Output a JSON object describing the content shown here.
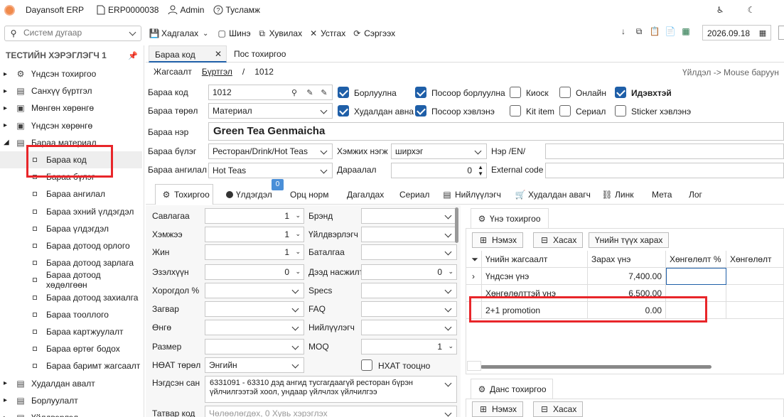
{
  "app": {
    "name": "Dayansoft ERP",
    "doc": "ERP0000038",
    "user": "Admin",
    "help": "Тусламж"
  },
  "search": {
    "placeholder": "Систем дугаар"
  },
  "toolbar": {
    "save": "Хадгалах",
    "new": "Шинэ",
    "copy": "Хувилах",
    "delete": "Устгах",
    "refresh": "Сэргээх",
    "date": "2026.09.18"
  },
  "sidebar": {
    "title": "ТЕСТИЙН ХЭРЭГЛЭГЧ 1",
    "items": [
      {
        "label": "Үндсэн тохиргоо",
        "level": 0
      },
      {
        "label": "Санхүү бүртгэл",
        "level": 0
      },
      {
        "label": "Мөнгөн хөрөнгө",
        "level": 0
      },
      {
        "label": "Үндсэн хөрөнгө",
        "level": 0
      },
      {
        "label": "Бараа материал",
        "level": 0
      },
      {
        "label": "Бараа код",
        "level": 1
      },
      {
        "label": "Бараа бүлэг",
        "level": 1
      },
      {
        "label": "Бараа ангилал",
        "level": 1
      },
      {
        "label": "Бараа эхний үлдэгдэл",
        "level": 1
      },
      {
        "label": "Бараа үлдэгдэл",
        "level": 1
      },
      {
        "label": "Бараа дотоод орлого",
        "level": 1
      },
      {
        "label": "Бараа дотоод зарлага",
        "level": 1
      },
      {
        "label": "Бараа дотоод хөдөлгөөн",
        "level": 1
      },
      {
        "label": "Бараа дотоод захиалга",
        "level": 1
      },
      {
        "label": "Бараа тооллого",
        "level": 1
      },
      {
        "label": "Бараа картжуулалт",
        "level": 1
      },
      {
        "label": "Бараа өртөг бодох",
        "level": 1
      },
      {
        "label": "Бараа баримт жагсаалт",
        "level": 1
      },
      {
        "label": "Худалдан авалт",
        "level": 0
      },
      {
        "label": "Борлуулалт",
        "level": 0
      },
      {
        "label": "Үйлдвэрлэл",
        "level": 0
      }
    ]
  },
  "tabs": {
    "t1": "Бараа код",
    "t2": "Пос тохиргоо"
  },
  "crumb": {
    "list": "Жагсаалт",
    "reg": "Бүртгэл",
    "slash": "/",
    "code": "1012",
    "hint": "Үйлдэл -> Mouse баруун"
  },
  "form": {
    "code_label": "Бараа код",
    "code": "1012",
    "type_label": "Бараа төрөл",
    "type": "Материал",
    "name_label": "Бараа нэр",
    "name": "Green Tea Genmaicha",
    "group_label": "Бараа бүлэг",
    "group": "Ресторан/Drink/Hot Teas",
    "cat_label": "Бараа ангилал",
    "cat": "Hot Teas",
    "unit_label": "Хэмжих нэгж",
    "unit": "ширхэг",
    "seq_label": "Дараалал",
    "seq": "0",
    "en_label": "Нэр /EN/",
    "ext_label": "External code"
  },
  "checks": {
    "c1": "Борлуулна",
    "c2": "Посоор борлуулна",
    "c3": "Киоск",
    "c4": "Онлайн",
    "c5": "Идэвхтэй",
    "c6": "Худалдан авна",
    "c7": "Посоор хэвлэнэ",
    "c8": "Kit item",
    "c9": "Сериал",
    "c10": "Sticker хэвлэнэ"
  },
  "subtabs": {
    "s1": "Тохиргоо",
    "s2": "Үлдэгдэл",
    "badge": "0",
    "s3": "Орц норм",
    "s4": "Дагалдах",
    "s5": "Сериал",
    "s6": "Нийлүүлэгч",
    "s7": "Худалдан авагч",
    "s8": "Линк",
    "s9": "Мета",
    "s10": "Лог"
  },
  "props": {
    "pack": "Савлагаа",
    "pack_v": "1",
    "size": "Хэмжээ",
    "size_v": "1",
    "weight": "Жин",
    "weight_v": "1",
    "vol": "Эзэлхүүн",
    "vol_v": "0",
    "disc": "Хорогдол %",
    "model": "Загвар",
    "color": "Өнгө",
    "sz": "Размер",
    "vat": "НӨАТ төрөл",
    "vat_v": "Энгийн",
    "cls": "Нэгдсэн сан",
    "cls_v": "6331091 - 63310 дэд ангид тусгагдаагүй ресторан бүрэн үйлчилгээтэй хоол, ундаар үйлчлэх үйлчилгээ",
    "tax": "Татвар код",
    "tax_v": "Чөлөөлөгдөх, 0 Хувь хэрэглэх",
    "brand": "Брэнд",
    "maker": "Үйлдвэрлэгч",
    "warranty": "Баталгаа",
    "maxbal": "Дээд насжилт",
    "maxbal_v": "0",
    "specs": "Specs",
    "faq": "FAQ",
    "supplier": "Нийлүүлэгч",
    "moq": "MOQ",
    "moq_v": "1",
    "nhat": "НХАТ тооцно"
  },
  "price": {
    "title": "Үнэ тохиргоо",
    "add": "Нэмэх",
    "remove": "Хасах",
    "history": "Үнийн түүх харах",
    "headers": [
      "Үнийн жагсаалт",
      "Зарах үнэ",
      "Хөнгөлөлт %",
      "Хөнгөлөлт"
    ],
    "rows": [
      {
        "name": "Үндсэн үнэ",
        "price": "7,400.00"
      },
      {
        "name": "Хөнгөлөлттэй үнэ",
        "price": "6,500.00"
      },
      {
        "name": "2+1 promotion",
        "price": "0.00"
      }
    ]
  },
  "account": {
    "title": "Данс тохиргоо",
    "add": "Нэмэх",
    "remove": "Хасах"
  },
  "colors": {
    "highlight": "#e8262a",
    "accent": "#1f5fa8"
  }
}
